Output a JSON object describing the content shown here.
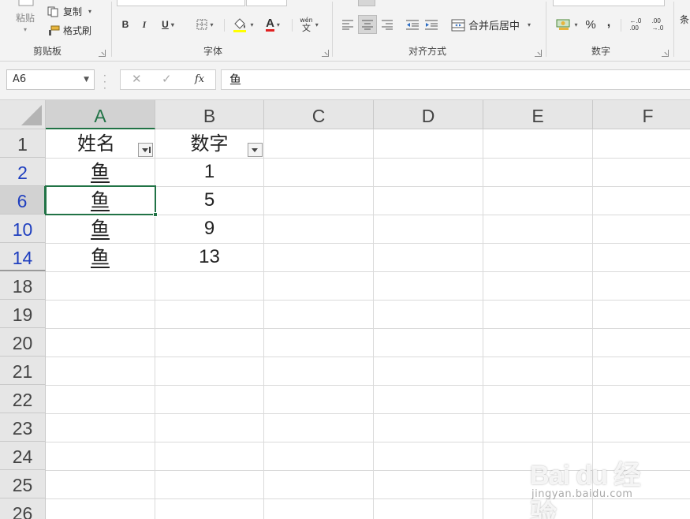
{
  "ribbon": {
    "clipboard": {
      "paste_label": "粘贴",
      "copy_label": "复制",
      "format_painter_label": "格式刷",
      "group_label": "剪贴板"
    },
    "font": {
      "bold": "B",
      "italic": "I",
      "underline": "U",
      "font_color_glyph": "A",
      "phonetic_top": "wén",
      "phonetic_bottom": "文",
      "group_label": "字体"
    },
    "alignment": {
      "merge_center_label": "合并后居中",
      "group_label": "对齐方式"
    },
    "number": {
      "percent": "%",
      "comma": ",",
      "increase_decimal_top": "←.0",
      "increase_decimal_bottom": ".00",
      "decrease_decimal_top": ".00",
      "decrease_decimal_bottom": "→.0",
      "group_label": "数字"
    },
    "cut_off_label": "条"
  },
  "formula_bar": {
    "name_box": "A6",
    "fx_label": "fx",
    "cancel_glyph": "✕",
    "enter_glyph": "✓",
    "content": "鱼"
  },
  "sheet": {
    "columns": [
      "A",
      "B",
      "C",
      "D",
      "E",
      "F"
    ],
    "rows": [
      {
        "num": "1",
        "a": "姓名",
        "b": "数字"
      },
      {
        "num": "2",
        "a": "鱼",
        "b": "1"
      },
      {
        "num": "6",
        "a": "鱼",
        "b": "5"
      },
      {
        "num": "10",
        "a": "鱼",
        "b": "9"
      },
      {
        "num": "14",
        "a": "鱼",
        "b": "13"
      },
      {
        "num": "18",
        "a": "",
        "b": ""
      },
      {
        "num": "19",
        "a": "",
        "b": ""
      },
      {
        "num": "20",
        "a": "",
        "b": ""
      },
      {
        "num": "21",
        "a": "",
        "b": ""
      },
      {
        "num": "22",
        "a": "",
        "b": ""
      },
      {
        "num": "23",
        "a": "",
        "b": ""
      },
      {
        "num": "24",
        "a": "",
        "b": ""
      },
      {
        "num": "25",
        "a": "",
        "b": ""
      },
      {
        "num": "26",
        "a": "",
        "b": ""
      }
    ],
    "active_cell": "A6"
  },
  "watermark": {
    "logo": "Bai du 经验",
    "url": "jingyan.baidu.com"
  },
  "colors": {
    "accent_green": "#217346",
    "filtered_row_blue": "#1f3fbf"
  }
}
